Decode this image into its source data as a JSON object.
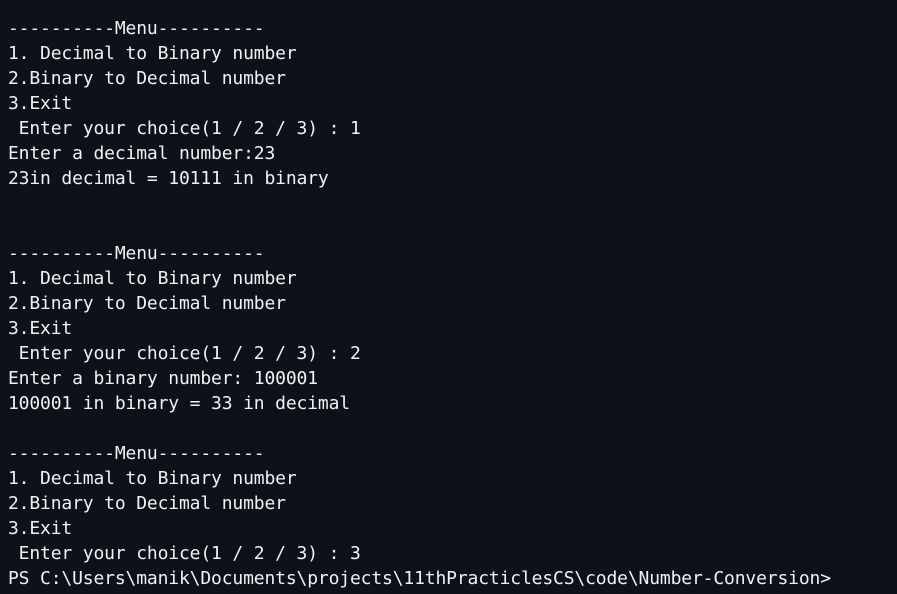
{
  "terminal": {
    "lines": [
      "----------Menu----------",
      "1. Decimal to Binary number",
      "2.Binary to Decimal number",
      "3.Exit",
      " Enter your choice(1 / 2 / 3) : 1",
      "Enter a decimal number:23",
      "23in decimal = 10111 in binary",
      "",
      "",
      "----------Menu----------",
      "1. Decimal to Binary number",
      "2.Binary to Decimal number",
      "3.Exit",
      " Enter your choice(1 / 2 / 3) : 2",
      "Enter a binary number: 100001",
      "100001 in binary = 33 in decimal",
      "",
      "----------Menu----------",
      "1. Decimal to Binary number",
      "2.Binary to Decimal number",
      "3.Exit",
      " Enter your choice(1 / 2 / 3) : 3"
    ],
    "prompt": "PS C:\\Users\\manik\\Documents\\projects\\11thPracticlesCS\\code\\Number-Conversion>"
  },
  "colors": {
    "background": "#0d111a",
    "text": "#f1f1f1"
  }
}
